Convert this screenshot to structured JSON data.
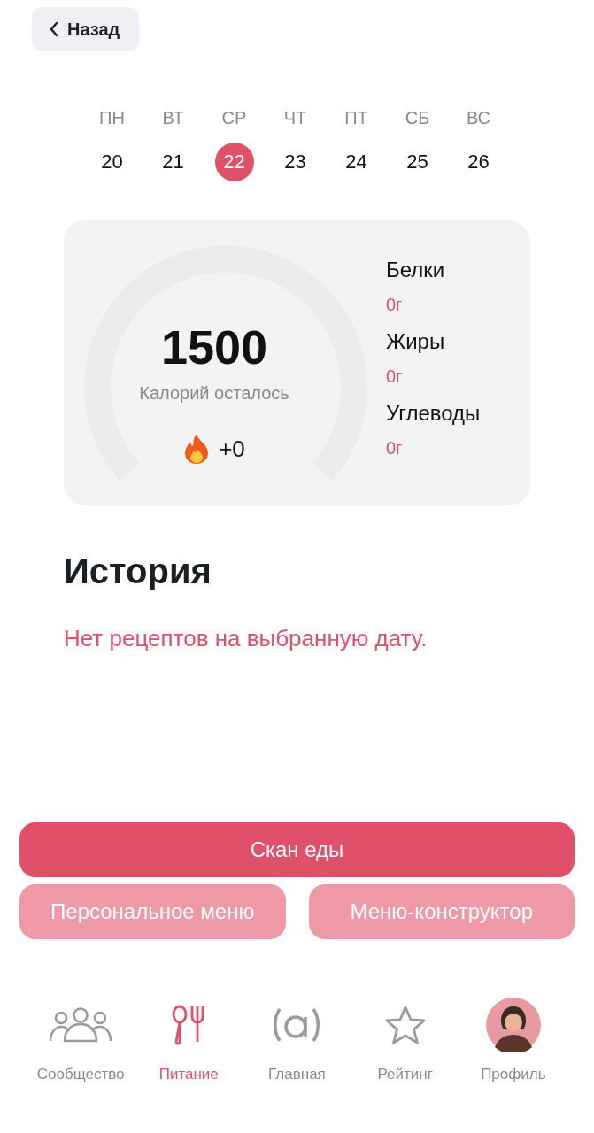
{
  "back_button": {
    "label": "Назад"
  },
  "week": [
    {
      "weekday": "ПН",
      "date": "20",
      "selected": false
    },
    {
      "weekday": "ВТ",
      "date": "21",
      "selected": false
    },
    {
      "weekday": "СР",
      "date": "22",
      "selected": true
    },
    {
      "weekday": "ЧТ",
      "date": "23",
      "selected": false
    },
    {
      "weekday": "ПТ",
      "date": "24",
      "selected": false
    },
    {
      "weekday": "СБ",
      "date": "25",
      "selected": false
    },
    {
      "weekday": "ВС",
      "date": "26",
      "selected": false
    }
  ],
  "summary": {
    "calories": "1500",
    "calories_label": "Калорий осталось",
    "burned": "+0",
    "macros": [
      {
        "name": "Белки",
        "value": "0г"
      },
      {
        "name": "Жиры",
        "value": "0г"
      },
      {
        "name": "Углеводы",
        "value": "0г"
      }
    ]
  },
  "history": {
    "title": "История",
    "empty_message": "Нет рецептов на выбранную дату."
  },
  "actions": {
    "primary": "Скан еды",
    "secondary": [
      "Персональное меню",
      "Меню-конструктор"
    ]
  },
  "nav": [
    {
      "kind": "community",
      "label": "Сообщество",
      "selected": false
    },
    {
      "kind": "food",
      "label": "Питание",
      "selected": true
    },
    {
      "kind": "home",
      "label": "Главная",
      "selected": false
    },
    {
      "kind": "rating",
      "label": "Рейтинг",
      "selected": false
    },
    {
      "kind": "profile",
      "label": "Профиль",
      "selected": false
    }
  ]
}
